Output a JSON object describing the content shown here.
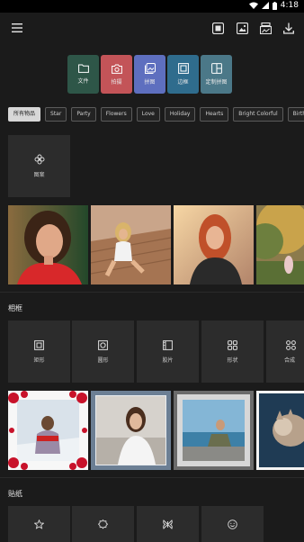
{
  "status": {
    "time": "4:18"
  },
  "toolbar": {
    "menu_icon": "hamburger-menu-icon",
    "actions": [
      "collage-icon",
      "image-icon",
      "stack-icon",
      "download-icon"
    ]
  },
  "quick_actions": [
    {
      "label": "文件",
      "icon": "folder-icon",
      "color": "#2e5648"
    },
    {
      "label": "拍摄",
      "icon": "camera-icon",
      "color": "#c35458"
    },
    {
      "label": "拼图",
      "icon": "collage-icon",
      "color": "#5e6fbf"
    },
    {
      "label": "边框",
      "icon": "frame-icon",
      "color": "#2f6c8d"
    },
    {
      "label": "定制拼图",
      "icon": "layout-icon",
      "color": "#4b7888"
    }
  ],
  "categories": [
    "所有物品",
    "Star",
    "Party",
    "Flowers",
    "Love",
    "Holiday",
    "Hearts",
    "Bright Colorful",
    "Birth"
  ],
  "active_category": "所有物品",
  "pattern_tile": {
    "label": "图案",
    "icon": "flower-icon"
  },
  "section_frames": {
    "title": "相框"
  },
  "frame_tiles": [
    {
      "label": "矩形",
      "icon": "square-frame-icon"
    },
    {
      "label": "圆形",
      "icon": "rounded-frame-icon"
    },
    {
      "label": "胶片",
      "icon": "film-frame-icon"
    },
    {
      "label": "形状",
      "icon": "shapes-icon"
    },
    {
      "label": "合成",
      "icon": "grid-icon"
    }
  ],
  "section_stickers": {
    "title": "贴纸"
  },
  "sticker_tiles": [
    {
      "label": "",
      "icon": "star-icon"
    },
    {
      "label": "",
      "icon": "badge-icon"
    },
    {
      "label": "",
      "icon": "butterfly-icon"
    },
    {
      "label": "",
      "icon": "smile-icon"
    }
  ]
}
